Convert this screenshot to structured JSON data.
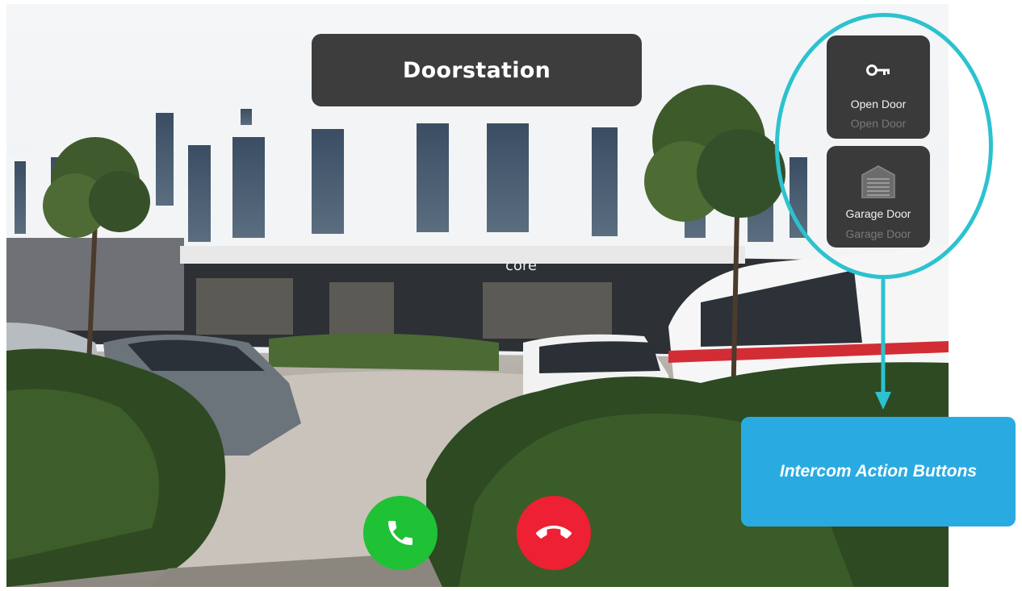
{
  "header": {
    "title": "Doorstation"
  },
  "scene": {
    "storefront_sign": "core"
  },
  "actions": [
    {
      "label": "Open Door",
      "sublabel": "Open Door",
      "icon": "key-icon"
    },
    {
      "label": "Garage Door",
      "sublabel": "Garage Door",
      "icon": "garage-door-icon"
    }
  ],
  "call": {
    "accept_icon": "phone-icon",
    "decline_icon": "phone-hangup-icon",
    "accept_color": "#1fc135",
    "decline_color": "#ee2033"
  },
  "annotation": {
    "callout": "Intercom Action Buttons",
    "ring_color": "#2cc2cf",
    "callout_color": "#29abe2"
  }
}
